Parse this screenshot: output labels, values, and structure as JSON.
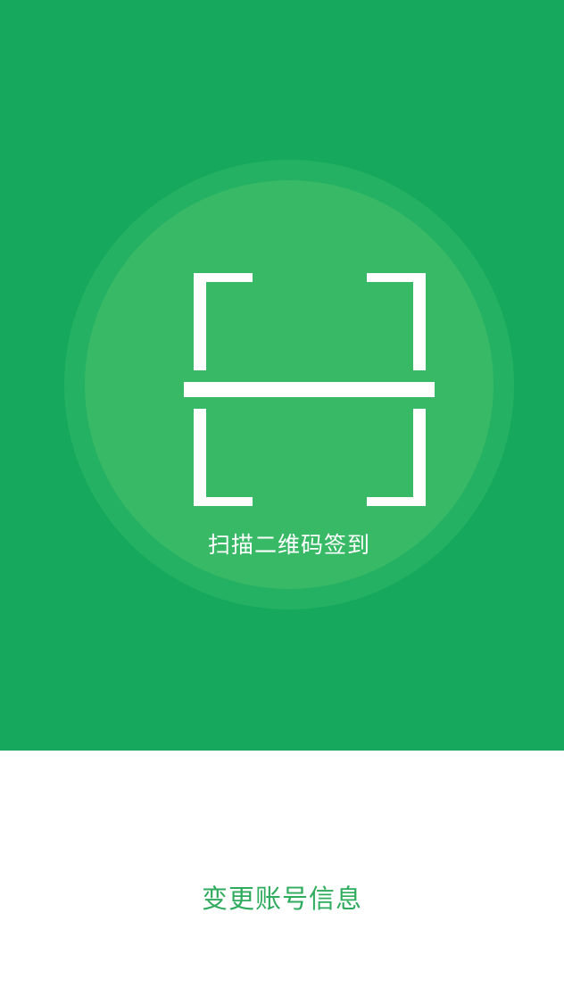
{
  "scan": {
    "icon": "qr-scan-frame-icon",
    "label": "扫描二维码签到"
  },
  "account": {
    "change_label": "变更账号信息"
  },
  "colors": {
    "primary_green": "#16a85d",
    "ring_green": "#24b163",
    "circle_green": "#37b966",
    "link_green": "#2eab5c",
    "white": "#ffffff"
  }
}
